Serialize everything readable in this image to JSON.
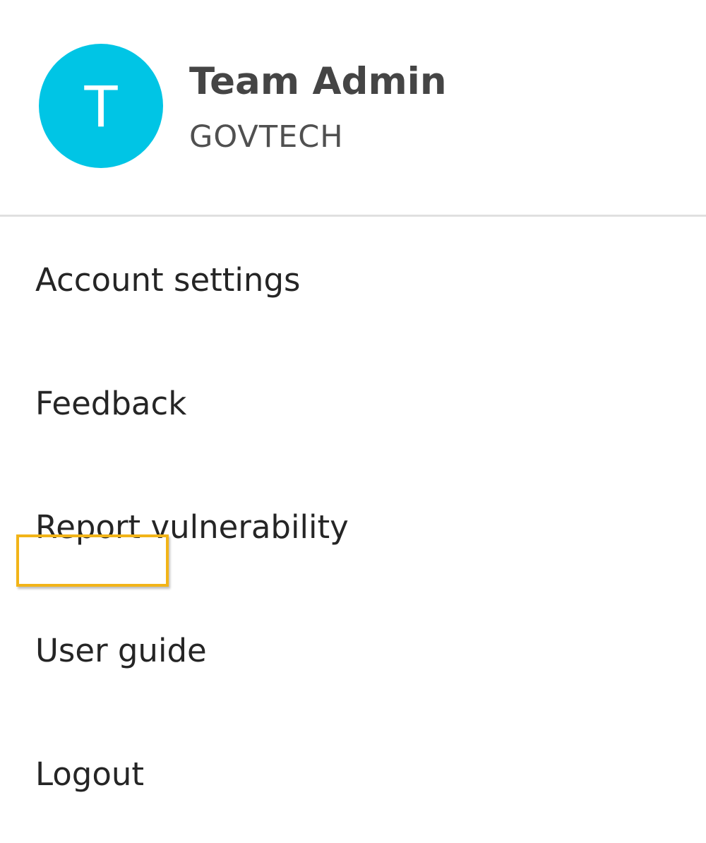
{
  "profile": {
    "avatar_initial": "T",
    "avatar_color": "#00c5e5",
    "name": "Team Admin",
    "organization": "GOVTECH"
  },
  "menu": {
    "items": [
      {
        "label": "Account settings"
      },
      {
        "label": "Feedback"
      },
      {
        "label": "Report vulnerability"
      },
      {
        "label": "User guide"
      },
      {
        "label": "Logout"
      }
    ],
    "highlighted_item": "Logout",
    "highlight_color": "#f2b418"
  }
}
